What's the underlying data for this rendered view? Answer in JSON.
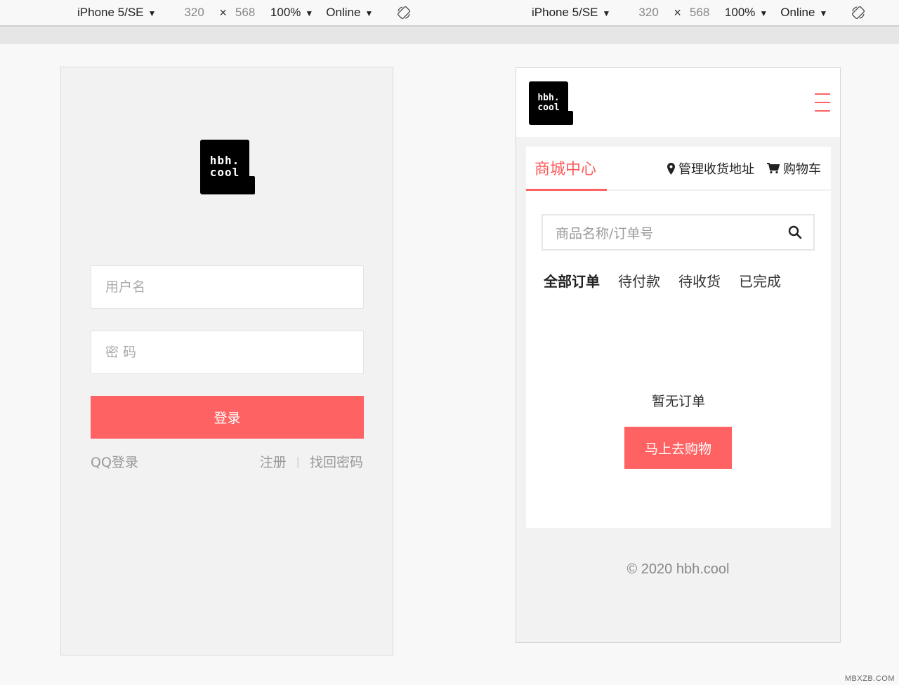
{
  "devtools": [
    {
      "device": "iPhone 5/SE",
      "width": "320",
      "times": "×",
      "height": "568",
      "zoom": "100%",
      "network": "Online"
    },
    {
      "device": "iPhone 5/SE",
      "width": "320",
      "times": "×",
      "height": "568",
      "zoom": "100%",
      "network": "Online"
    }
  ],
  "login": {
    "logo_line1": "hbh.",
    "logo_line2": "cool",
    "username_placeholder": "用户名",
    "password_placeholder": "密 码",
    "login_button": "登录",
    "qq_login": "QQ登录",
    "register": "注册",
    "separator": "|",
    "forgot_password": "找回密码"
  },
  "shop": {
    "logo_line1": "hbh.",
    "logo_line2": "cool",
    "tab_active": "商城中心",
    "address_link": "管理收货地址",
    "cart_link": "购物车",
    "search_placeholder": "商品名称/订单号",
    "order_tabs": [
      "全部订单",
      "待付款",
      "待收货",
      "已完成"
    ],
    "empty_text": "暂无订单",
    "shop_button": "马上去购物",
    "footer": "© 2020 hbh.cool"
  },
  "watermark": "MBXZB.COM",
  "colors": {
    "accent": "#ff6262",
    "page_bg": "#f8f8f8",
    "panel_bg": "#f2f2f2"
  }
}
